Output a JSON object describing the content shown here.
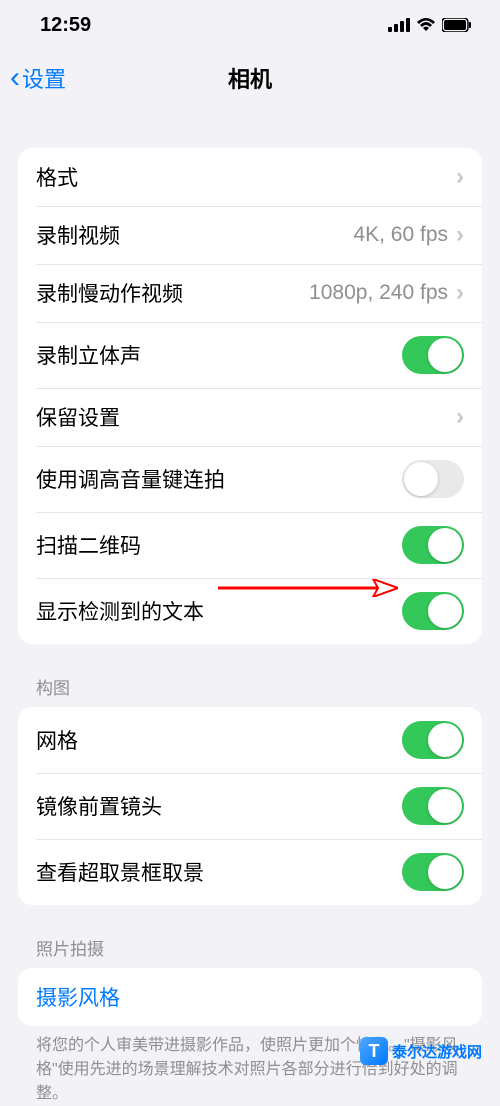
{
  "status": {
    "time": "12:59"
  },
  "nav": {
    "back": "设置",
    "title": "相机"
  },
  "group1": {
    "rows": [
      {
        "label": "格式",
        "detail": ""
      },
      {
        "label": "录制视频",
        "detail": "4K, 60 fps"
      },
      {
        "label": "录制慢动作视频",
        "detail": "1080p, 240 fps"
      },
      {
        "label": "录制立体声",
        "on": true
      },
      {
        "label": "保留设置",
        "detail": ""
      },
      {
        "label": "使用调高音量键连拍",
        "on": false
      },
      {
        "label": "扫描二维码",
        "on": true
      },
      {
        "label": "显示检测到的文本",
        "on": true
      }
    ]
  },
  "group2": {
    "header": "构图",
    "rows": [
      {
        "label": "网格",
        "on": true
      },
      {
        "label": "镜像前置镜头",
        "on": true
      },
      {
        "label": "查看超取景框取景",
        "on": true
      }
    ]
  },
  "group3": {
    "header": "照片拍摄",
    "rows": [
      {
        "label": "摄影风格"
      }
    ],
    "footer": "将您的个人审美带进摄影作品，使照片更加个性化。\"摄影风格\"使用先进的场景理解技术对照片各部分进行恰到好处的调整。"
  },
  "watermark": "泰尔达游戏网"
}
